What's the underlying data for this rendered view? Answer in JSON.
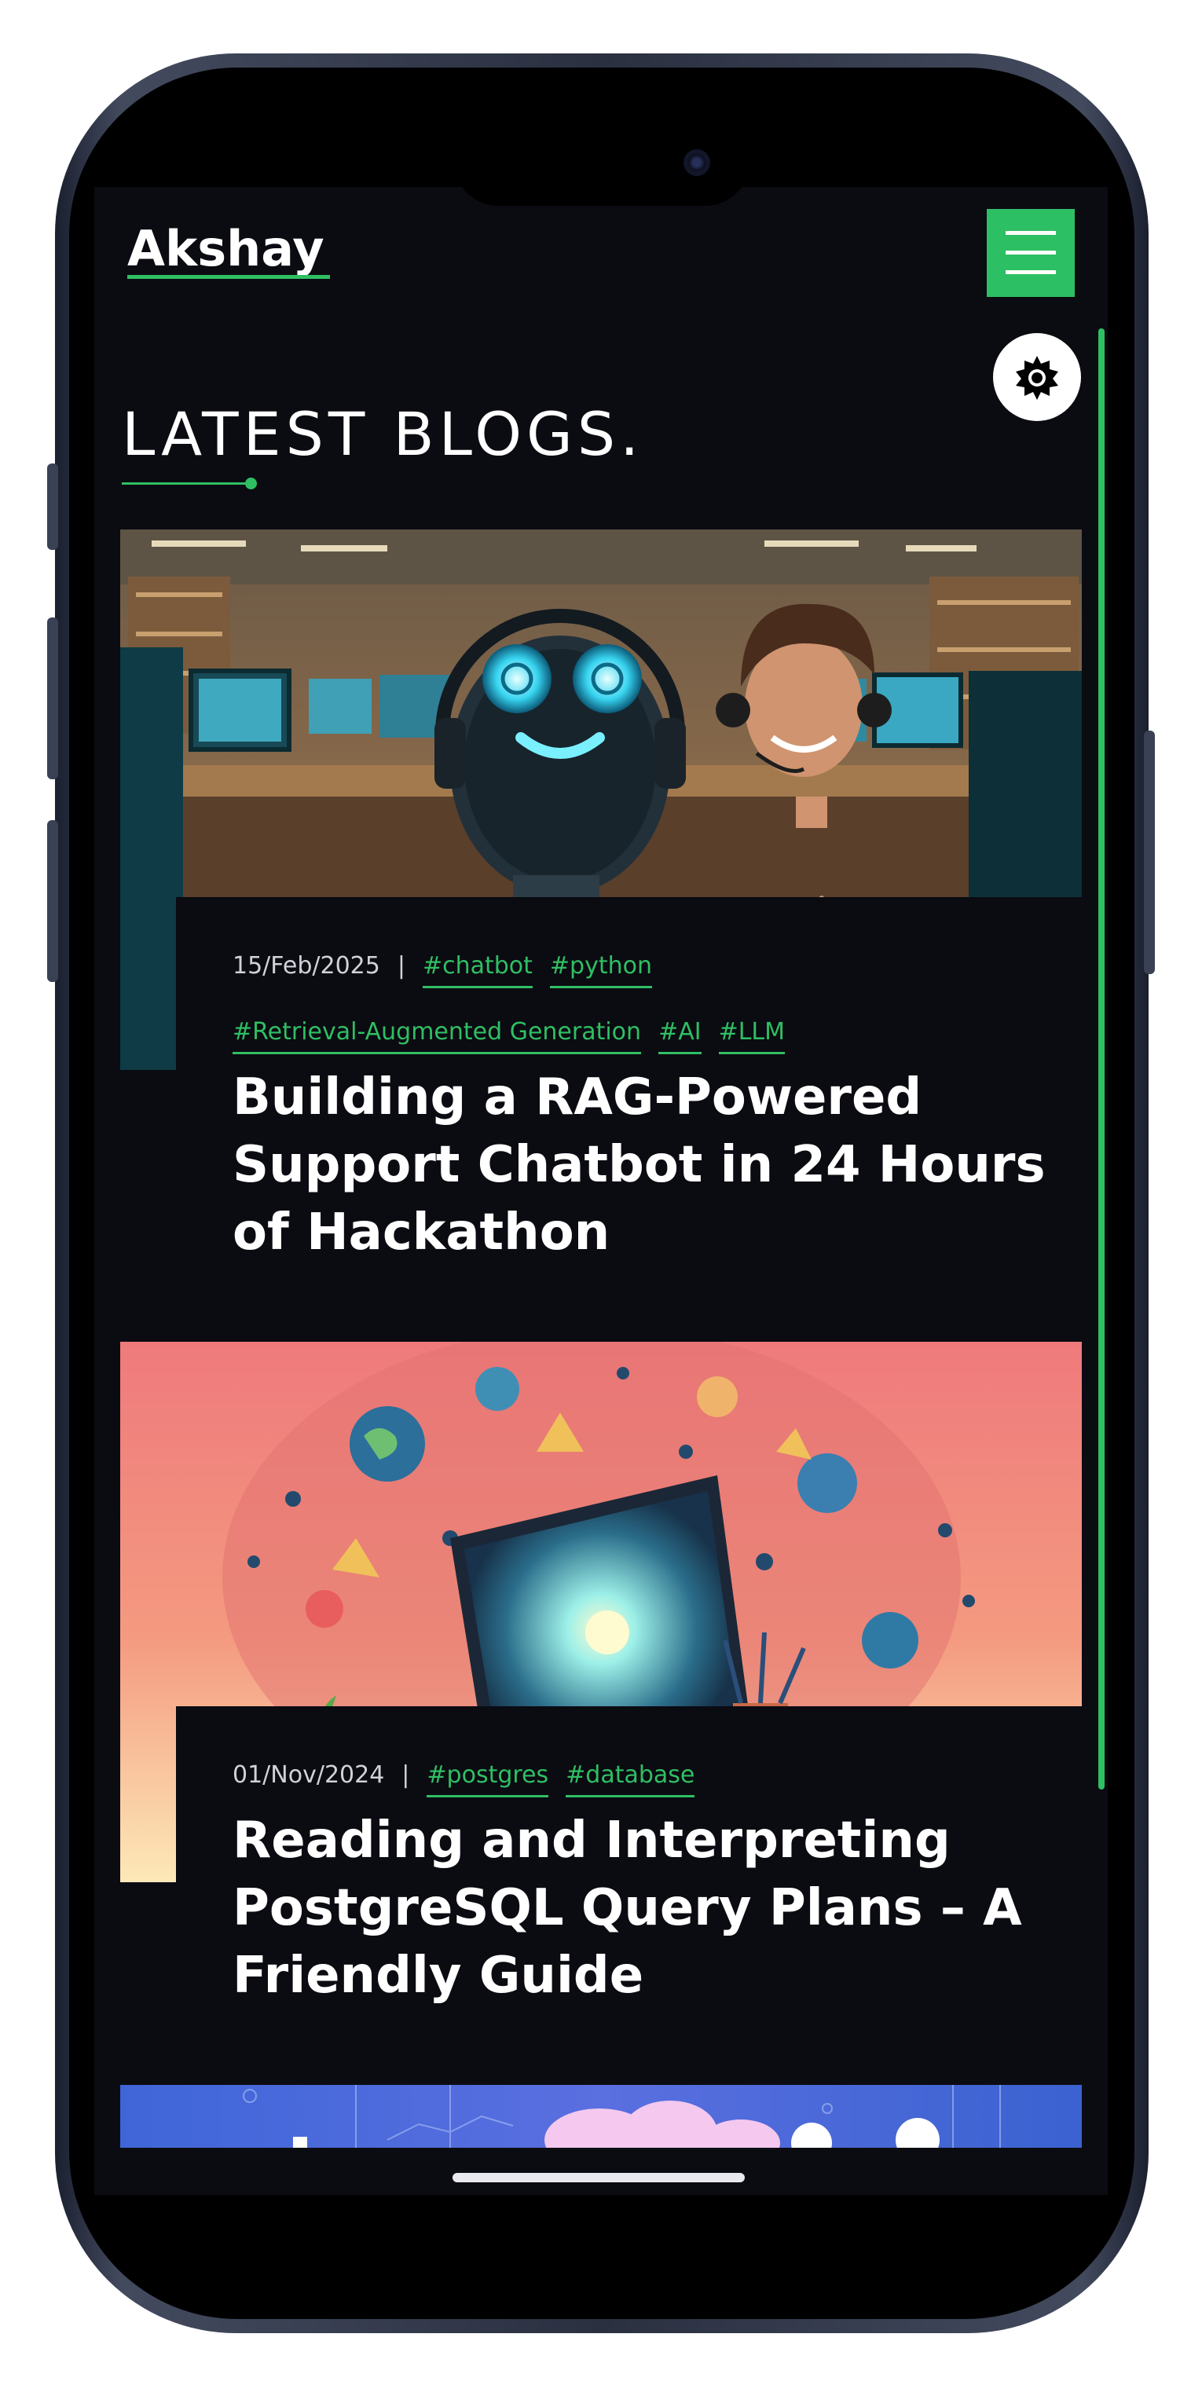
{
  "header": {
    "logo": "Akshay",
    "menu_icon": "hamburger-icon",
    "theme_icon": "sun-gear-icon"
  },
  "section": {
    "title": "LATEST BLOGS."
  },
  "posts": [
    {
      "date": "15/Feb/2025",
      "tags": [
        "#chatbot",
        "#python",
        "#Retrieval-Augmented Generation",
        "#AI",
        "#LLM"
      ],
      "title": "Building a RAG-Powered Support Chatbot in 24 Hours of Hackathon",
      "image": "robot-and-man-in-lab-illustration"
    },
    {
      "date": "01/Nov/2024",
      "tags": [
        "#postgres",
        "#database"
      ],
      "title": "Reading and Interpreting PostgreSQL Query Plans – A Friendly Guide",
      "image": "laptop-vortex-illustration"
    },
    {
      "image": "cloud-network-illustration"
    }
  ],
  "colors": {
    "accent": "#2fbf63",
    "background": "#0b0b12",
    "text": "#ffffff"
  }
}
